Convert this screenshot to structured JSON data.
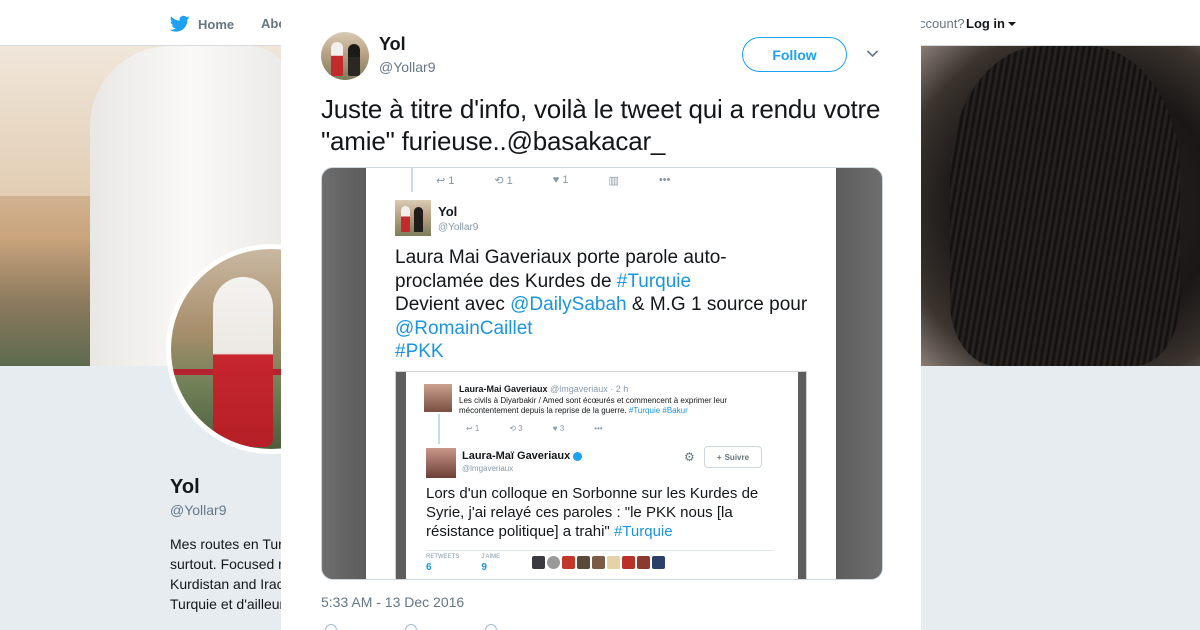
{
  "nav": {
    "home_label": "Home",
    "about_fragment": "Abo",
    "account_fragment": "ccount?",
    "login_label": "Log in"
  },
  "profile": {
    "name": "Yol",
    "handle": "@Yollar9",
    "bio_lines": [
      "Mes routes en Tur",
      "surtout. Focused r",
      "Kurdistan and Irac",
      "Turquie et d'ailleur"
    ]
  },
  "tweet": {
    "author_name": "Yol",
    "author_handle": "@Yollar9",
    "follow_label": "Follow",
    "text": "Juste à titre d'info, voilà le tweet qui a rendu votre \"amie\" furieuse..@basakacar_",
    "timestamp": "5:33 AM - 13 Dec 2016"
  },
  "embedded": {
    "top_actions": [
      "↩ 1",
      "⟲ 1",
      "♥ 1",
      "▥",
      "•••"
    ],
    "author_name": "Yol",
    "author_handle": "@Yollar9",
    "text_parts": [
      {
        "t": "Laura Mai Gaveriaux  porte parole auto-proclamée des Kurdes de ",
        "link": false
      },
      {
        "t": "#Turquie",
        "link": true
      },
      {
        "t": " Devient avec ",
        "link": false
      },
      {
        "t": "@DailySabah",
        "link": true
      },
      {
        "t": " & M.G 1 source pour ",
        "link": false
      },
      {
        "t": "@RomainCaillet",
        "link": true
      },
      {
        "t": " ",
        "link": false
      },
      {
        "t": "#PKK",
        "link": true
      }
    ],
    "quoted": {
      "first_name": "Laura-Mai Gaveriaux",
      "first_meta": "@lmgaveriaux · 2 h",
      "first_text": "Les civils à Diyarbakir / Amed sont écœurés et commencent à exprimer leur mécontentement depuis la reprise de la guerre.",
      "first_tags": "#Turquie #Bakur",
      "first_actions": [
        "↩ 1",
        "⟲ 3",
        "♥ 3",
        "•••"
      ],
      "second_name": "Laura-Maï Gaveriaux",
      "second_handle": "@lmgaveriaux",
      "follow_label": "Suivre",
      "second_text": "Lors d'un colloque en Sorbonne sur les Kurdes de Syrie, j'ai relayé ces paroles :  \"le PKK nous [la résistance politique] a trahi\" ",
      "second_tag": "#Turquie",
      "retweets_label": "RETWEETS",
      "retweets_value": "6",
      "likes_label": "J'AIME",
      "likes_value": "9"
    }
  },
  "colors": {
    "accent": "#1da1f2",
    "link": "#1b95e0",
    "text": "#14171a",
    "muted": "#657786"
  },
  "icons": [
    "twitter-bird-icon",
    "close-icon",
    "chevron-down-icon",
    "gear-icon",
    "add-user-icon",
    "verified-icon"
  ]
}
